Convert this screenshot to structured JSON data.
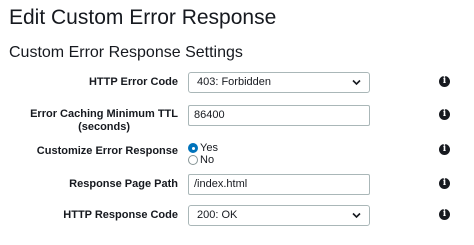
{
  "page_title": "Edit Custom Error Response",
  "section_title": "Custom Error Response Settings",
  "fields": {
    "http_error_code": {
      "label": "HTTP Error Code",
      "value": "403: Forbidden"
    },
    "error_caching_ttl": {
      "label_line1": "Error Caching Minimum TTL",
      "label_line2": "(seconds)",
      "value": "86400"
    },
    "customize_error_response": {
      "label": "Customize Error Response",
      "options": [
        "Yes",
        "No"
      ],
      "selected": "Yes"
    },
    "response_page_path": {
      "label": "Response Page Path",
      "value": "/index.html"
    },
    "http_response_code": {
      "label": "HTTP Response Code",
      "value": "200: OK"
    }
  },
  "icons": {
    "info": "info-icon",
    "dropdown": "chevron-down-icon"
  },
  "info_glyph": "i",
  "colors": {
    "radio_selected": "#0073bb",
    "text": "#16191f",
    "border": "#aab7b8"
  }
}
